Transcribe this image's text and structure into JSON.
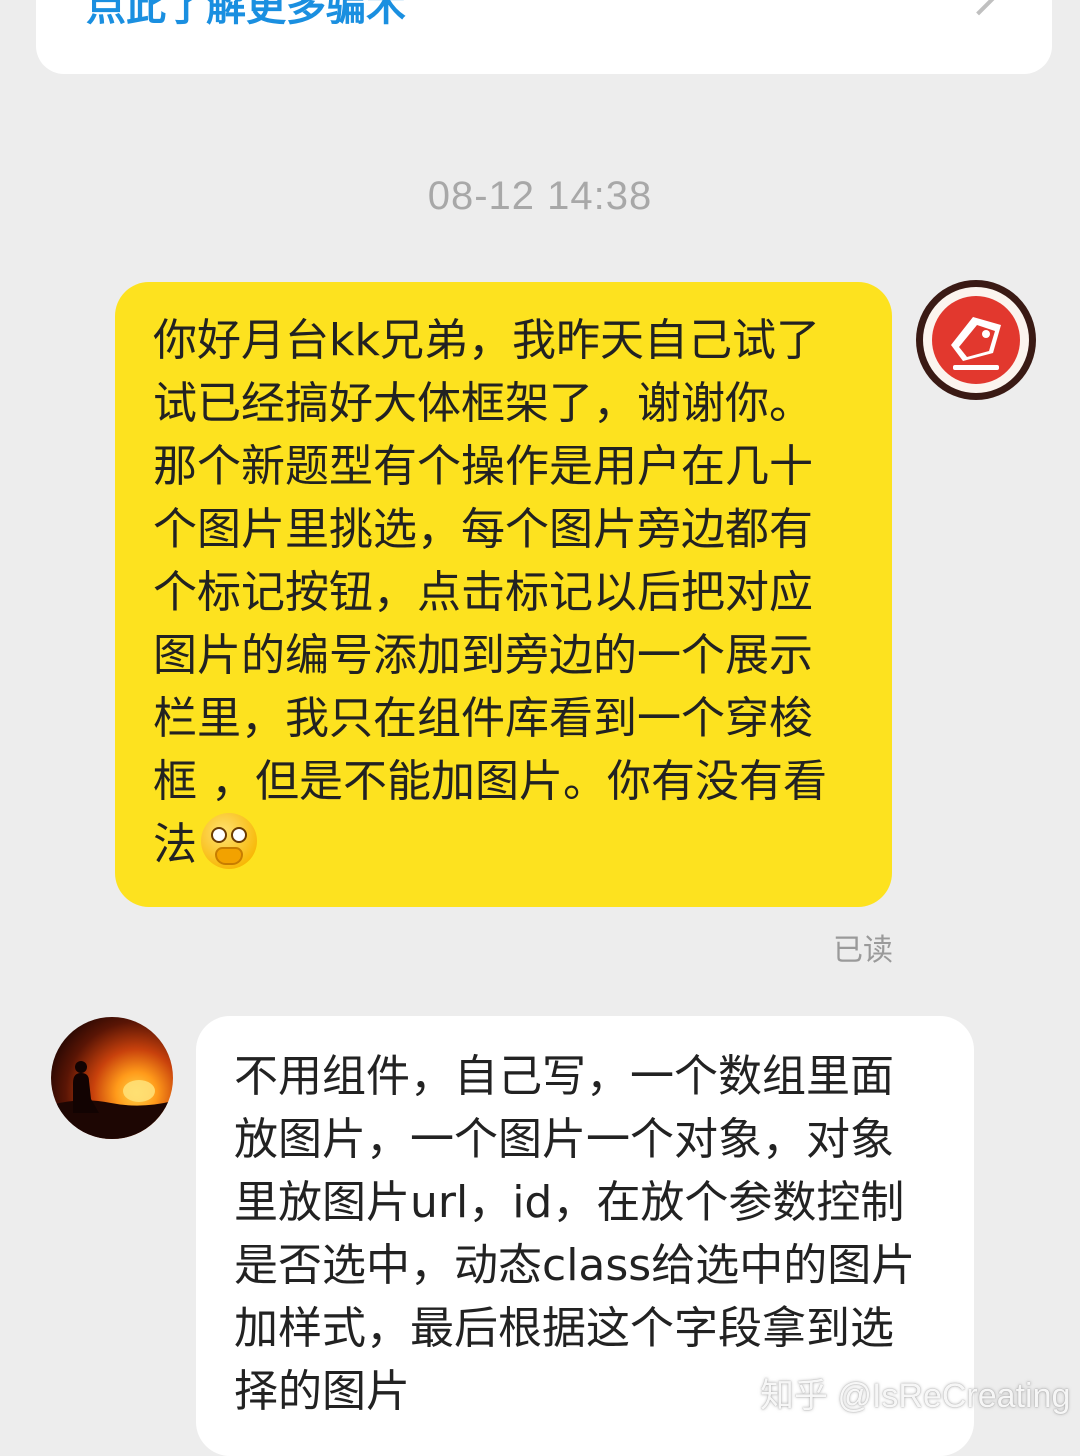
{
  "top_card": {
    "link_text": "点此了解更多骗术"
  },
  "timestamp": "08-12 14:38",
  "messages": [
    {
      "direction": "outgoing",
      "text": "你好月台kk兄弟，我昨天自己试了试已经搞好大体框架了，谢谢你。 那个新题型有个操作是用户在几十个图片里挑选，每个图片旁边都有个标记按钮，点击标记以后把对应图片的编号添加到旁边的一个展示栏里，我只在组件库看到一个穿梭框 ，但是不能加图片。你有没有看法",
      "emoji": "flushed-face-emoji",
      "status": "已读",
      "bubble_color": "#fde21f"
    },
    {
      "direction": "incoming",
      "text": "不用组件，自己写，一个数组里面放图片，一个图片一个对象，对象里放图片url，id，在放个参数控制是否选中，动态class给选中的图片加样式，最后根据这个字段拿到选择的图片",
      "bubble_color": "#ffffff"
    }
  ],
  "watermark": "知乎 @IsReCreating",
  "colors": {
    "background": "#ededed",
    "link": "#1a8fe0",
    "timestamp": "#a8a8a8"
  }
}
